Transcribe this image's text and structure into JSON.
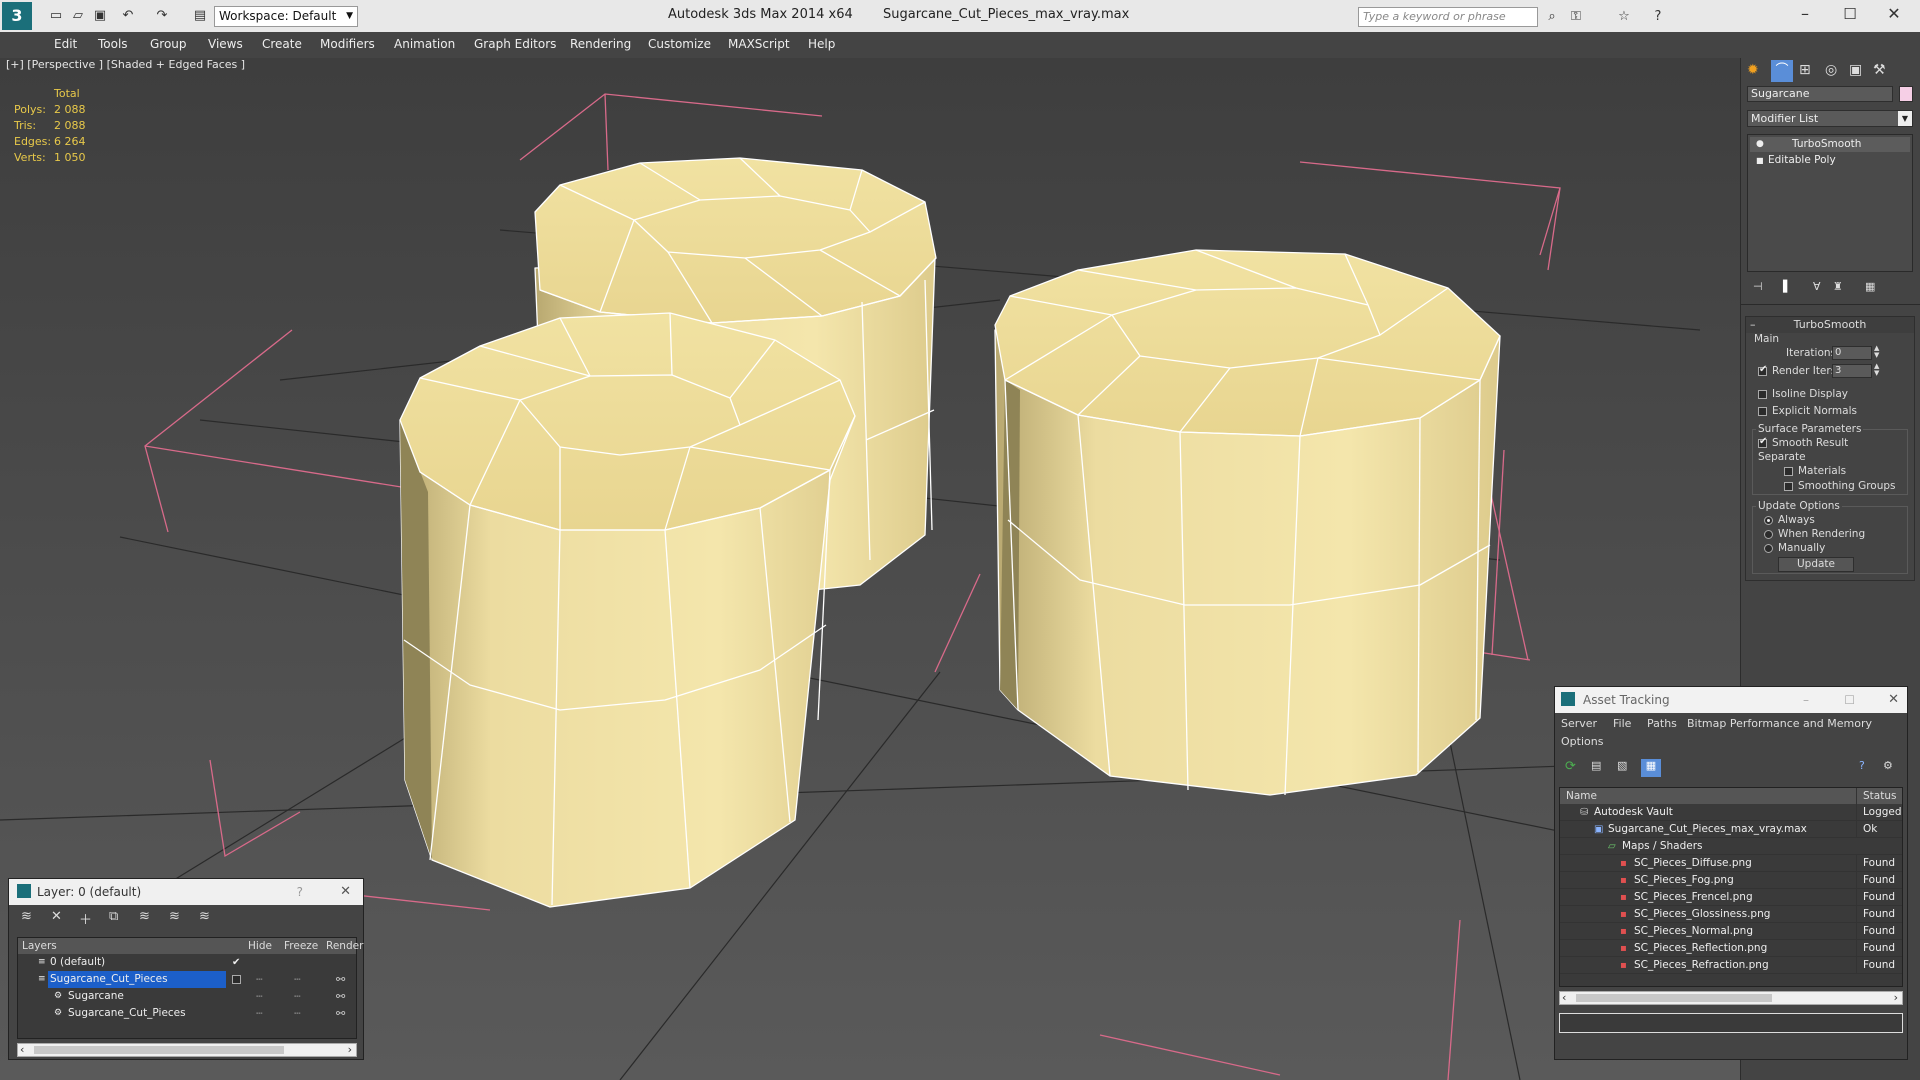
{
  "titlebar": {
    "app_title": "Autodesk 3ds Max  2014 x64",
    "file_name": "Sugarcane_Cut_Pieces_max_vray.max",
    "workspace_label": "Workspace: Default",
    "search_placeholder": "Type a keyword or phrase"
  },
  "menu": [
    "Edit",
    "Tools",
    "Group",
    "Views",
    "Create",
    "Modifiers",
    "Animation",
    "Graph Editors",
    "Rendering",
    "Customize",
    "MAXScript",
    "Help"
  ],
  "viewport": {
    "label": "[+] [Perspective ] [Shaded + Edged Faces ]",
    "stats_header": "Total",
    "stats": [
      {
        "label": "Polys:",
        "value": "2 088"
      },
      {
        "label": "Tris:",
        "value": "2 088"
      },
      {
        "label": "Edges:",
        "value": "6 264"
      },
      {
        "label": "Verts:",
        "value": "1 050"
      }
    ]
  },
  "command_panel": {
    "object_name": "Sugarcane",
    "modifier_list": "Modifier List",
    "stack": [
      "TurboSmooth",
      "Editable Poly"
    ],
    "rollout_title": "TurboSmooth",
    "main_label": "Main",
    "iterations_label": "Iterations:",
    "iterations_value": "0",
    "render_iters_label": "Render Iters:",
    "render_iters_value": "3",
    "isoline": "Isoline Display",
    "explicit_normals": "Explicit Normals",
    "surface_params": "Surface Parameters",
    "smooth_result": "Smooth Result",
    "separate": "Separate",
    "materials": "Materials",
    "smoothing_groups": "Smoothing Groups",
    "update_options": "Update Options",
    "always": "Always",
    "when_rendering": "When Rendering",
    "manually": "Manually",
    "update_button": "Update"
  },
  "layer_window": {
    "title": "Layer: 0 (default)",
    "columns": [
      "Layers",
      "Hide",
      "Freeze",
      "Render"
    ],
    "rows": [
      "0 (default)",
      "Sugarcane_Cut_Pieces",
      "Sugarcane",
      "Sugarcane_Cut_Pieces"
    ]
  },
  "asset_window": {
    "title": "Asset Tracking",
    "menu": [
      "Server",
      "File",
      "Paths",
      "Bitmap Performance and Memory",
      "Options"
    ],
    "columns": [
      "Name",
      "Status"
    ],
    "rows": [
      {
        "name": "Autodesk Vault",
        "status": "Logged O"
      },
      {
        "name": "Sugarcane_Cut_Pieces_max_vray.max",
        "status": "Ok"
      },
      {
        "name": "Maps / Shaders",
        "status": ""
      },
      {
        "name": "SC_Pieces_Diffuse.png",
        "status": "Found"
      },
      {
        "name": "SC_Pieces_Fog.png",
        "status": "Found"
      },
      {
        "name": "SC_Pieces_Frencel.png",
        "status": "Found"
      },
      {
        "name": "SC_Pieces_Glossiness.png",
        "status": "Found"
      },
      {
        "name": "SC_Pieces_Normal.png",
        "status": "Found"
      },
      {
        "name": "SC_Pieces_Reflection.png",
        "status": "Found"
      },
      {
        "name": "SC_Pieces_Refraction.png",
        "status": "Found"
      }
    ]
  },
  "colors": {
    "accent": "#1c5fc9",
    "object_fill": "#eedc98",
    "stats_text": "#e8c94a",
    "bbox_lines": "#d86a8a"
  }
}
